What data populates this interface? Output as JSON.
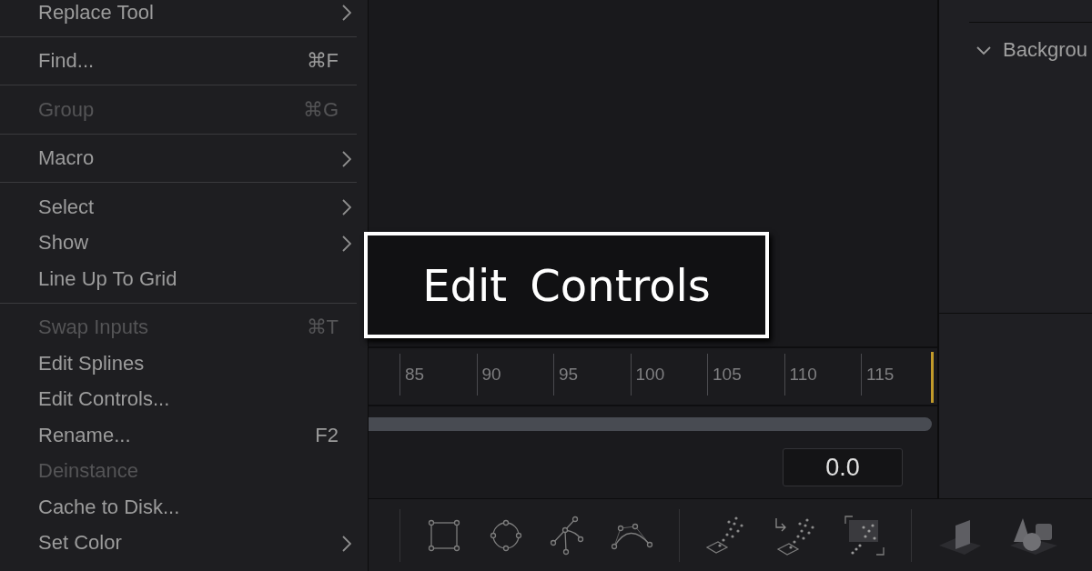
{
  "menu": {
    "items": [
      {
        "label": "Replace Tool",
        "submenu": true,
        "disabled": false,
        "separator_after": true
      },
      {
        "label": "Find...",
        "shortcut": "⌘F",
        "submenu": false,
        "disabled": false,
        "separator_after": true
      },
      {
        "label": "Group",
        "shortcut": "⌘G",
        "submenu": false,
        "disabled": true,
        "separator_after": true
      },
      {
        "label": "Macro",
        "submenu": true,
        "disabled": false,
        "separator_after": true
      },
      {
        "label": "Select",
        "submenu": true,
        "disabled": false,
        "separator_after": false
      },
      {
        "label": "Show",
        "submenu": true,
        "disabled": false,
        "separator_after": false
      },
      {
        "label": "Line Up To Grid",
        "submenu": false,
        "disabled": false,
        "separator_after": true
      },
      {
        "label": "Swap Inputs",
        "shortcut": "⌘T",
        "submenu": false,
        "disabled": true,
        "separator_after": false
      },
      {
        "label": "Edit Splines",
        "submenu": false,
        "disabled": false,
        "separator_after": false
      },
      {
        "label": "Edit Controls...",
        "submenu": false,
        "disabled": false,
        "separator_after": false
      },
      {
        "label": "Rename...",
        "shortcut": "F2",
        "submenu": false,
        "disabled": false,
        "separator_after": false
      },
      {
        "label": "Deinstance",
        "submenu": false,
        "disabled": true,
        "separator_after": false
      },
      {
        "label": "Cache to Disk...",
        "submenu": false,
        "disabled": false,
        "separator_after": false
      },
      {
        "label": "Set Color",
        "submenu": true,
        "disabled": false,
        "separator_after": false
      }
    ]
  },
  "title_overlay": {
    "text": "Edit Controls"
  },
  "timeline": {
    "ticks": [
      "85",
      "90",
      "95",
      "100",
      "105",
      "110",
      "115"
    ]
  },
  "value_field": {
    "value": "0.0"
  },
  "inspector": {
    "section": {
      "title": "Backgrou",
      "expanded": true
    }
  }
}
